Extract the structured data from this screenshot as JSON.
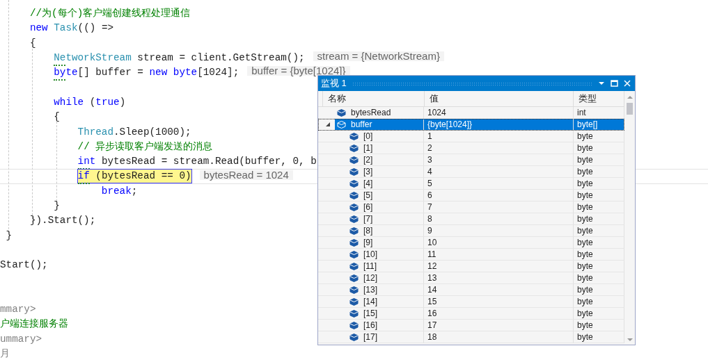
{
  "editor": {
    "lines": [
      {
        "tokens": [
          {
            "kind": "comment",
            "text": "     //为(每个)客户端创建线程处理通信"
          }
        ],
        "current": false,
        "hint_dots": false
      },
      {
        "tokens": [
          {
            "kind": "keyword",
            "text": "     new"
          },
          {
            "kind": "type",
            "text": " Task"
          },
          {
            "kind": "plain",
            "text": "(() =>"
          }
        ],
        "current": false,
        "hint_dots": false
      },
      {
        "tokens": [
          {
            "kind": "plain",
            "text": "     {"
          }
        ],
        "current": false,
        "hint_dots": false
      },
      {
        "tokens": [
          {
            "kind": "type",
            "text": "         NetworkStream"
          },
          {
            "kind": "plain",
            "text": " stream = client.GetStream();"
          }
        ],
        "tip": "stream = {NetworkStream}",
        "current": false,
        "hint_dots": true
      },
      {
        "tokens": [
          {
            "kind": "keyword",
            "text": "         byte"
          },
          {
            "kind": "plain",
            "text": "[] buffer = "
          },
          {
            "kind": "keyword",
            "text": "new"
          },
          {
            "kind": "keyword",
            "text": " byte"
          },
          {
            "kind": "plain",
            "text": "[1024];"
          }
        ],
        "tip": "buffer = {byte[1024]}",
        "current": false,
        "hint_dots": true
      },
      {
        "current": false,
        "hint_dots": false
      },
      {
        "tokens": [
          {
            "kind": "keyword",
            "text": "         while"
          },
          {
            "kind": "plain",
            "text": " ("
          },
          {
            "kind": "keyword",
            "text": "true"
          },
          {
            "kind": "plain",
            "text": ")"
          }
        ],
        "current": false,
        "hint_dots": false
      },
      {
        "tokens": [
          {
            "kind": "plain",
            "text": "         {"
          }
        ],
        "current": false,
        "hint_dots": false
      },
      {
        "tokens": [
          {
            "kind": "type",
            "text": "             Thread"
          },
          {
            "kind": "plain",
            "text": ".Sleep(1000);"
          }
        ],
        "current": false,
        "hint_dots": false
      },
      {
        "tokens": [
          {
            "kind": "comment",
            "text": "             // 异步读取客户端发送的消息"
          }
        ],
        "current": false,
        "hint_dots": false
      },
      {
        "tokens": [
          {
            "kind": "keyword",
            "text": "             int"
          },
          {
            "kind": "plain",
            "text": " bytesRead = stream.Read(buffer, 0, b"
          }
        ],
        "current": false,
        "hint_dots": true
      },
      {
        "tokens": [
          {
            "kind": "keyword",
            "text": "             if"
          },
          {
            "kind": "plain",
            "text": " (bytesRead == 0)"
          }
        ],
        "tip": "bytesRead = 1024",
        "current": true,
        "hint_dots": true
      },
      {
        "tokens": [
          {
            "kind": "keyword",
            "text": "                 break"
          },
          {
            "kind": "plain",
            "text": ";"
          }
        ],
        "current": false,
        "hint_dots": false
      },
      {
        "tokens": [
          {
            "kind": "plain",
            "text": "         }"
          }
        ],
        "current": false,
        "hint_dots": false
      },
      {
        "tokens": [
          {
            "kind": "plain",
            "text": "     }).Start();"
          }
        ],
        "current": false,
        "hint_dots": false
      },
      {
        "tokens": [
          {
            "kind": "plain",
            "text": " }"
          }
        ],
        "current": false,
        "hint_dots": false
      },
      {
        "current": false,
        "hint_dots": false
      },
      {
        "tokens": [
          {
            "kind": "plain",
            "text": "Start();"
          }
        ],
        "current": false,
        "hint_dots": false
      },
      {
        "current": false,
        "hint_dots": false
      },
      {
        "current": false,
        "hint_dots": false
      },
      {
        "tokens": [
          {
            "kind": "doc",
            "text": "mmary>"
          }
        ],
        "current": false,
        "hint_dots": false
      },
      {
        "tokens": [
          {
            "kind": "comment",
            "text": "户端连接服务器"
          }
        ],
        "current": false,
        "hint_dots": false
      },
      {
        "tokens": [
          {
            "kind": "doc",
            "text": "ummary>"
          }
        ],
        "current": false,
        "hint_dots": false
      },
      {
        "tokens": [
          {
            "kind": "doc",
            "text": "月"
          }
        ],
        "current": false,
        "hint_dots": false
      }
    ]
  },
  "watch": {
    "title": "监视 1",
    "columns": [
      "名称",
      "值",
      "类型"
    ],
    "rows": [
      {
        "name": "bytesRead",
        "value": "1024",
        "type": "int",
        "selected": false
      },
      {
        "name": "buffer",
        "value": "{byte[1024]}",
        "type": "byte[]",
        "selected": true,
        "expanded": true,
        "children": [
          {
            "name": "[0]",
            "value": "1",
            "type": "byte",
            "selected": false
          },
          {
            "name": "[1]",
            "value": "2",
            "type": "byte",
            "selected": false
          },
          {
            "name": "[2]",
            "value": "3",
            "type": "byte",
            "selected": false
          },
          {
            "name": "[3]",
            "value": "4",
            "type": "byte",
            "selected": false
          },
          {
            "name": "[4]",
            "value": "5",
            "type": "byte",
            "selected": false
          },
          {
            "name": "[5]",
            "value": "6",
            "type": "byte",
            "selected": false
          },
          {
            "name": "[6]",
            "value": "7",
            "type": "byte",
            "selected": false
          },
          {
            "name": "[7]",
            "value": "8",
            "type": "byte",
            "selected": false
          },
          {
            "name": "[8]",
            "value": "9",
            "type": "byte",
            "selected": false
          },
          {
            "name": "[9]",
            "value": "10",
            "type": "byte",
            "selected": false
          },
          {
            "name": "[10]",
            "value": "11",
            "type": "byte",
            "selected": false
          },
          {
            "name": "[11]",
            "value": "12",
            "type": "byte",
            "selected": false
          },
          {
            "name": "[12]",
            "value": "13",
            "type": "byte",
            "selected": false
          },
          {
            "name": "[13]",
            "value": "14",
            "type": "byte",
            "selected": false
          },
          {
            "name": "[14]",
            "value": "15",
            "type": "byte",
            "selected": false
          },
          {
            "name": "[15]",
            "value": "16",
            "type": "byte",
            "selected": false
          },
          {
            "name": "[16]",
            "value": "17",
            "type": "byte",
            "selected": false
          },
          {
            "name": "[17]",
            "value": "18",
            "type": "byte",
            "selected": false
          }
        ]
      }
    ]
  }
}
